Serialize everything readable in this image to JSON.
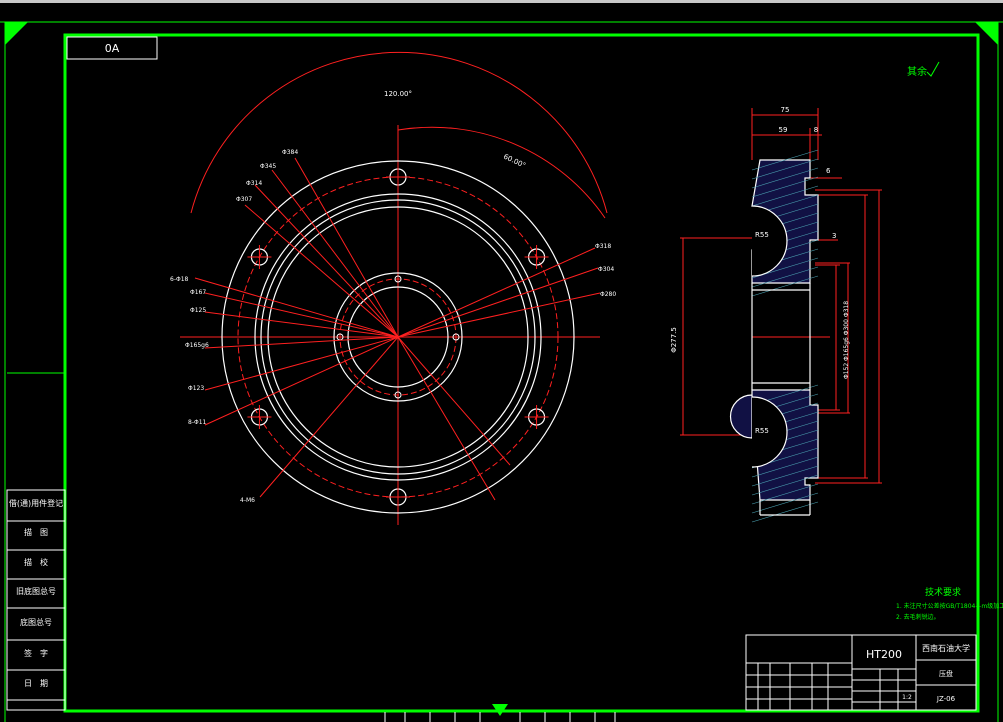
{
  "drawing": {
    "number_box": "0A",
    "roughness_note": "其余",
    "angle_top": "120.00°",
    "angle_right": "60.00°",
    "left_callouts": [
      "Φ384",
      "Φ345",
      "Φ314",
      "Φ307",
      "6-Φ18",
      "Φ167",
      "Φ125",
      "Φ165g6",
      "Φ123",
      "8-Φ11",
      "4-M6"
    ],
    "right_callouts": [
      "Φ318",
      "Φ304",
      "Φ280"
    ],
    "side_dims": {
      "top_width": "75",
      "inner_width": "59",
      "small_width": "8",
      "step": "6",
      "small_gap": "3",
      "left_dia": "Φ277.5",
      "center_dias": "Φ152 Φ165g6 Φ300 Φ318",
      "radius_top": "R55",
      "radius_bottom": "R55"
    },
    "tech_title": "技术要求",
    "tech_lines": [
      "1. 未注尺寸公差按GB/T1804—m级加工。",
      "2. 去毛刺锐边。"
    ]
  },
  "side_labels": [
    "借(通)用件登记",
    "描　图",
    "描　校",
    "旧底图总号",
    "底图总号",
    "签　字",
    "日　期"
  ],
  "title_block": {
    "material": "HT200",
    "school": "西南石油大学",
    "part_name": "压盘",
    "drawing_code": "JZ-06",
    "scale": "1:2"
  }
}
